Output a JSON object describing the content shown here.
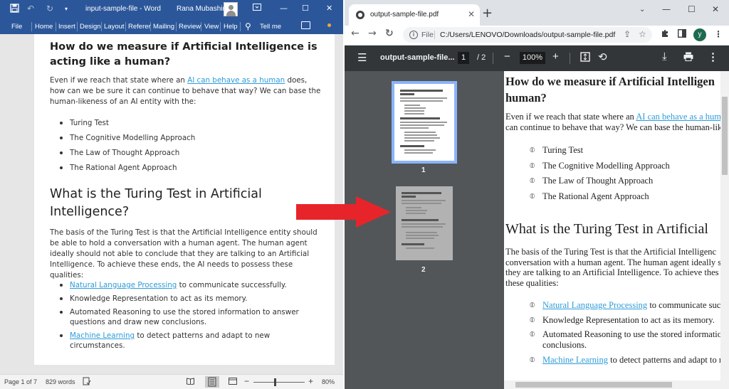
{
  "word": {
    "doc_title": "input-sample-file  -  Word",
    "user_name": "Rana Mubashir",
    "tabs": [
      "File",
      "Home",
      "Insert",
      "Design",
      "Layout",
      "Referer",
      "Mailing",
      "Review",
      "View",
      "Help"
    ],
    "tell_me": "Tell me",
    "heading1": "How do we measure if Artificial Intelligence is acting like a human?",
    "para1_pre": "Even if we reach that state where an ",
    "para1_link": "AI can behave as a human",
    "para1_post": " does, how can we be sure it can continue to behave that way? We can base the human-likeness of an AI entity with the:",
    "list1": [
      "Turing Test",
      "The Cognitive Modelling Approach",
      "The Law of Thought Approach",
      "The Rational Agent Approach"
    ],
    "heading2": "What is the Turing Test in Artificial Intelligence?",
    "para2": "The basis of the Turing Test is that the Artificial Intelligence entity should be able to hold a conversation with a human agent. The human agent ideally should not able to conclude that they are talking to an Artificial Intelligence. To achieve these ends, the AI needs to possess these qualities:",
    "list2": {
      "i1_link": "Natural Language Processing",
      "i1_rest": " to communicate successfully.",
      "i2": "Knowledge Representation to act as its memory.",
      "i3": "Automated Reasoning to use the stored information to answer questions and draw new conclusions.",
      "i4_link": "Machine Learning",
      "i4_rest": " to detect patterns and adapt to new circumstances."
    },
    "status": {
      "page": "Page 1 of 7",
      "words": "829 words",
      "zoom": "80%"
    }
  },
  "chrome": {
    "tab_title": "output-sample-file.pdf",
    "url_scheme": "File",
    "url": "C:/Users/LENOVO/Downloads/output-sample-file.pdf",
    "profile_initial": "y"
  },
  "pdf": {
    "file_name": "output-sample-file...",
    "current_page": "1",
    "total_pages": "/  2",
    "zoom": "100%",
    "thumb_labels": [
      "1",
      "2"
    ],
    "heading1_line1": "How do we measure if Artificial Intelligen",
    "heading1_line2": "human?",
    "para1_l1_pre": "Even if we reach that state where an ",
    "para1_l1_link": "AI can behave as a human",
    "para1_l2": "can continue to behave that way? We can base the human-lik",
    "list1": [
      "Turing Test",
      "The Cognitive Modelling Approach",
      "The Law of Thought Approach",
      "The Rational Agent Approach"
    ],
    "heading2": "What is the Turing Test in Artificial",
    "para2_lines": [
      "The basis of the Turing Test is that the Artificial Intelligenc",
      "conversation with a human agent. The human agent ideally s",
      "they are talking to an Artificial Intelligence. To achieve thes",
      "these qualities:"
    ],
    "list2": {
      "i1_link": "Natural Language Processing",
      "i1_rest": " to communicate success",
      "i2": "Knowledge Representation to act as its memory.",
      "i3_l1": "Automated Reasoning to use the stored information to",
      "i3_l2": "conclusions.",
      "i4_link": "Machine Learning",
      "i4_rest": " to detect patterns and adapt to new"
    }
  }
}
